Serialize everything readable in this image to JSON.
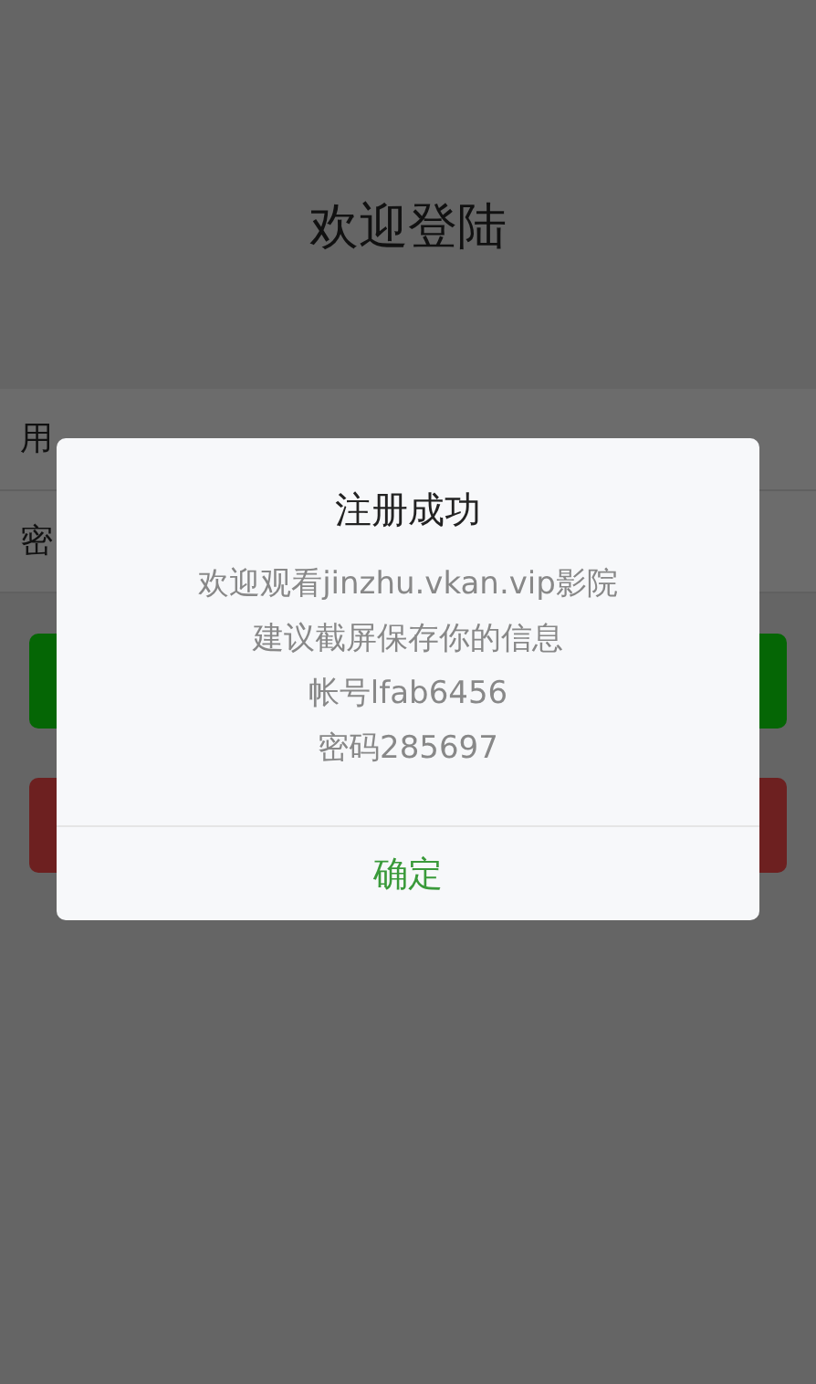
{
  "title": "欢迎登陆",
  "form": {
    "rows": [
      {
        "label": "用"
      },
      {
        "label": "密"
      }
    ]
  },
  "buttons": [
    {
      "kind": "primary"
    },
    {
      "kind": "danger"
    }
  ],
  "dialog": {
    "title": "注册成功",
    "lines": [
      "欢迎观看jinzhu.vkan.vip影院",
      "建议截屏保存你的信息",
      "帐号lfab6456",
      "密码285697"
    ],
    "confirm": "确定"
  }
}
